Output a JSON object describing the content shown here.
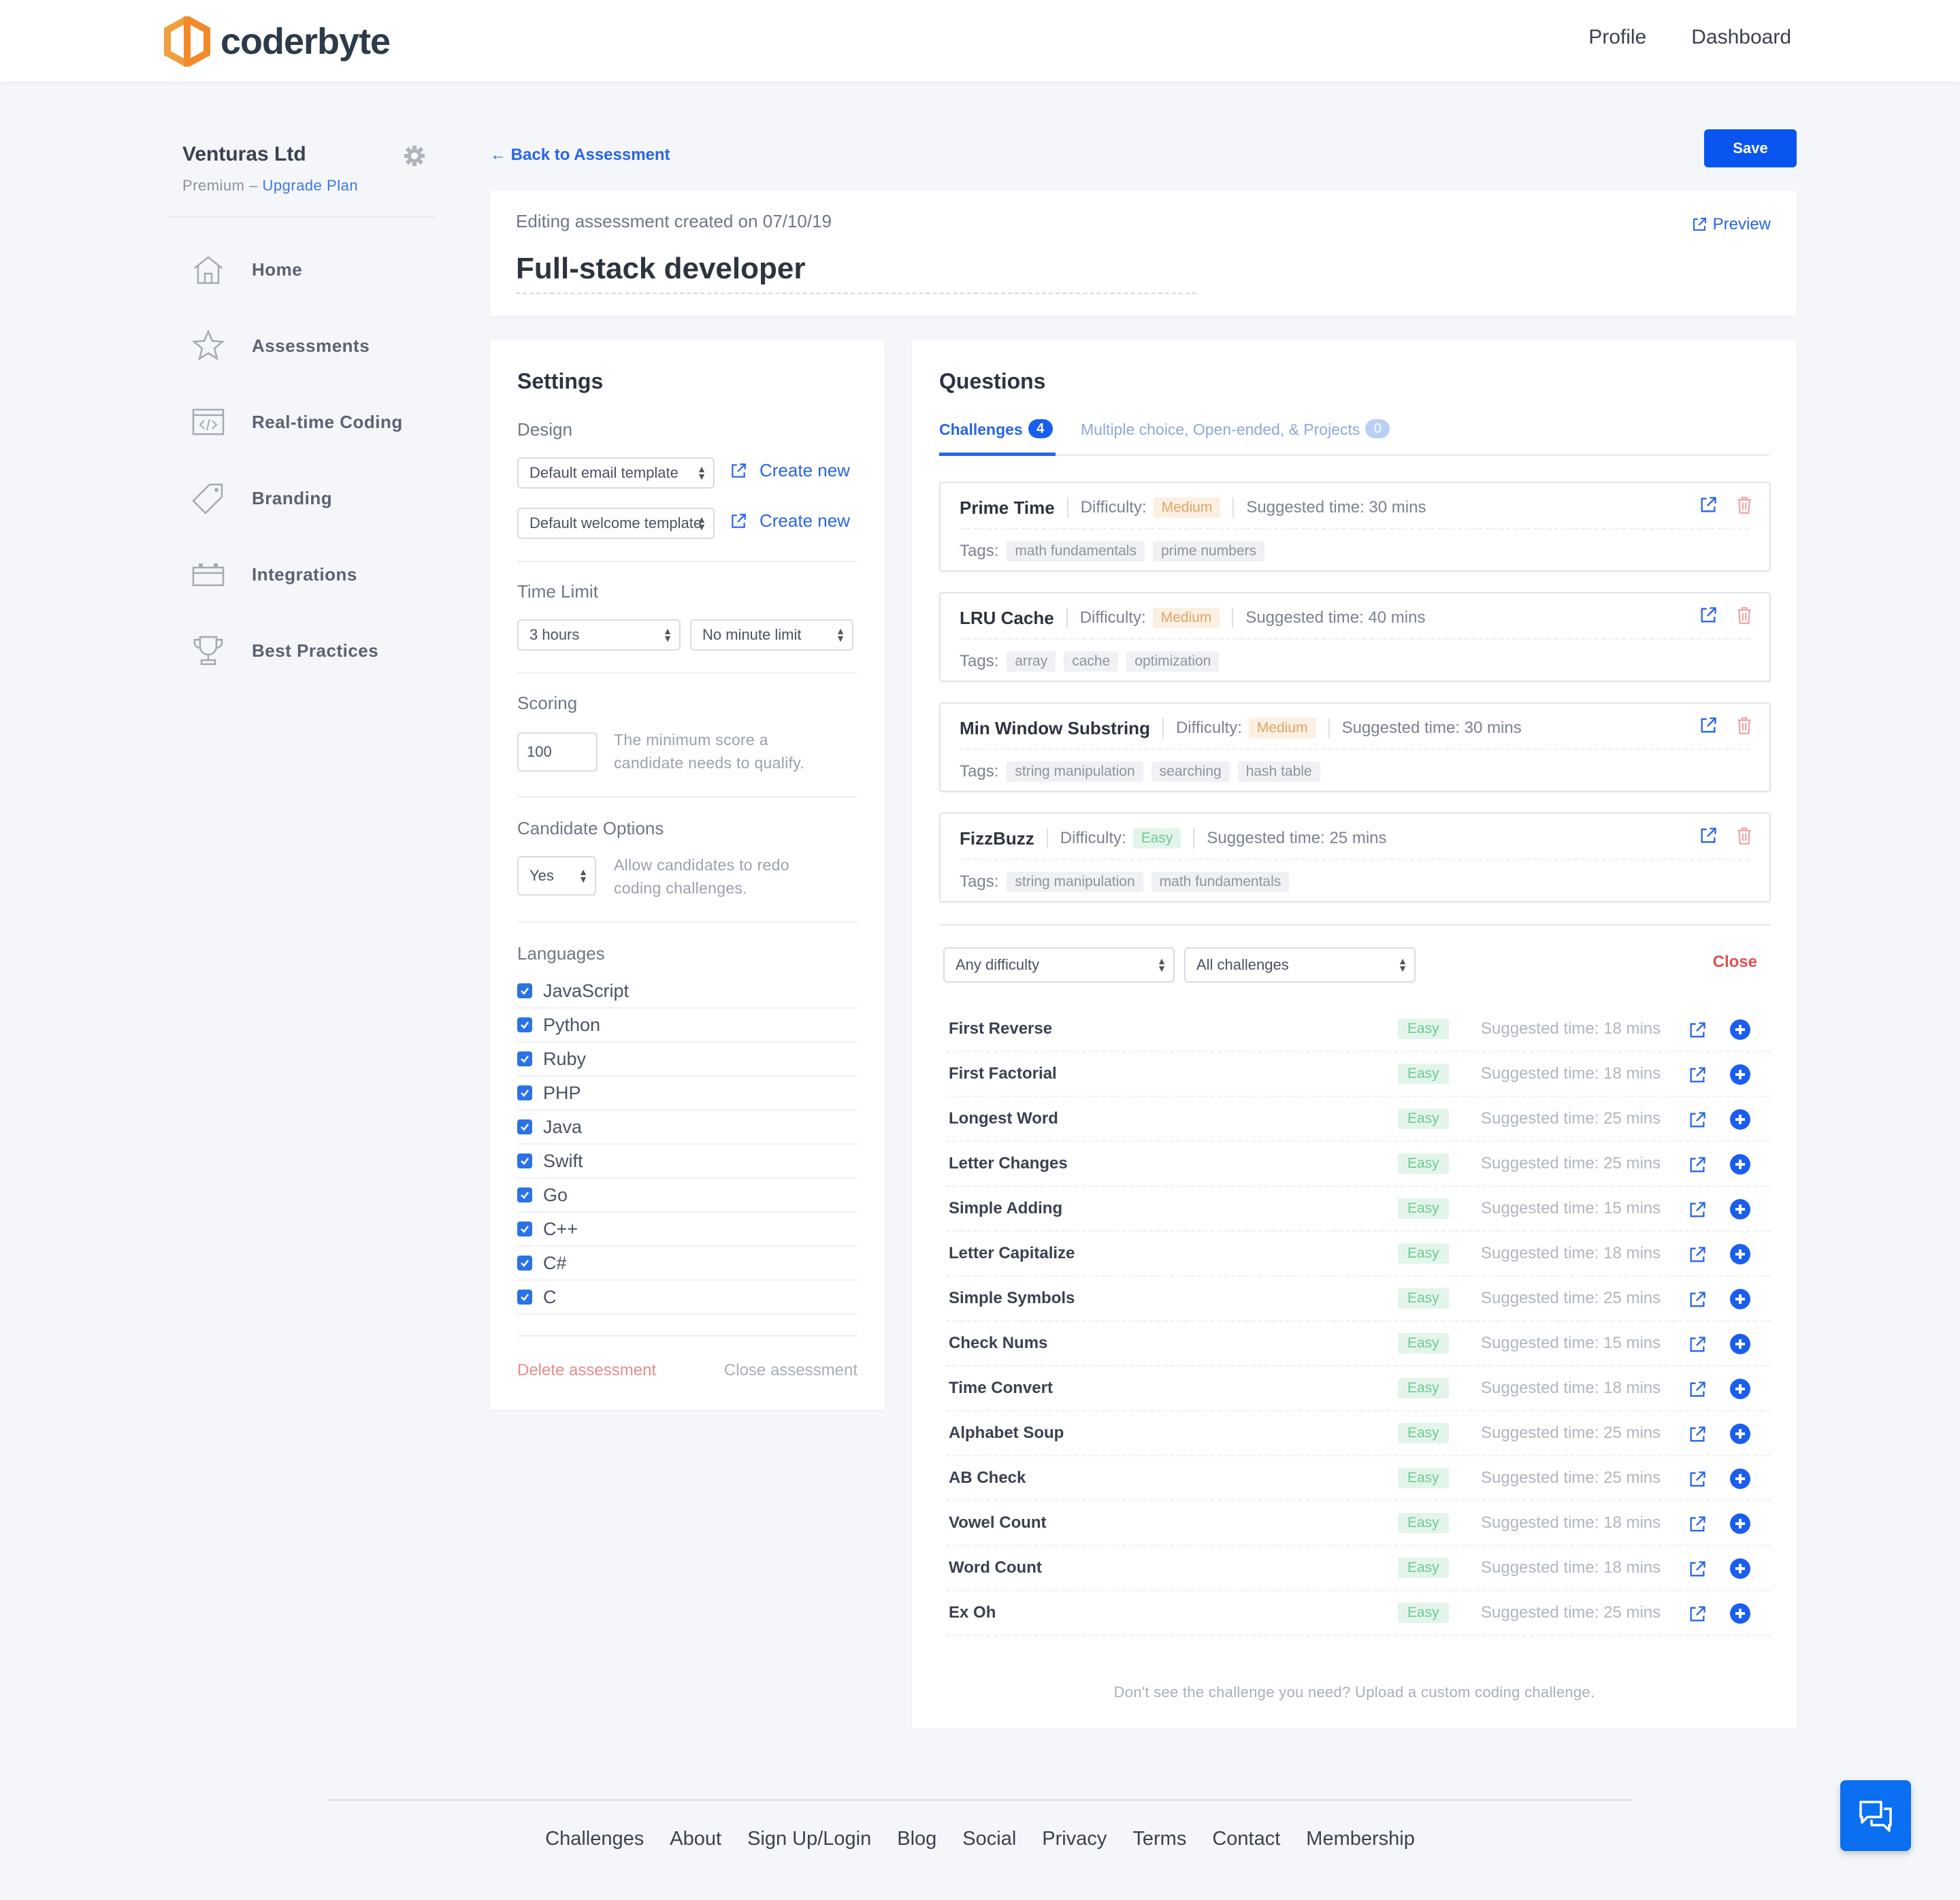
{
  "brand": {
    "name": "coderbyte"
  },
  "topnav": [
    "Profile",
    "Dashboard"
  ],
  "sidebar": {
    "org": "Venturas Ltd",
    "plan": "Premium",
    "plan_sep": "–",
    "upgrade": "Upgrade Plan",
    "items": [
      {
        "label": "Home",
        "icon": "home-icon"
      },
      {
        "label": "Assessments",
        "icon": "star-icon"
      },
      {
        "label": "Real-time Coding",
        "icon": "code-window-icon"
      },
      {
        "label": "Branding",
        "icon": "tag-icon"
      },
      {
        "label": "Integrations",
        "icon": "plug-icon"
      },
      {
        "label": "Best Practices",
        "icon": "trophy-icon"
      }
    ]
  },
  "back_label": "← Back to Assessment",
  "save_label": "Save",
  "header": {
    "subtitle": "Editing assessment created on 07/10/19",
    "title": "Full-stack developer",
    "preview": "Preview"
  },
  "settings": {
    "title": "Settings",
    "design_label": "Design",
    "email_template": "Default email template",
    "welcome_template": "Default welcome template",
    "create_new": "Create new",
    "time_limit_label": "Time Limit",
    "hours": "3 hours",
    "minutes": "No minute limit",
    "scoring_label": "Scoring",
    "score": "100",
    "scoring_help": "The minimum score a candidate needs to qualify.",
    "candidate_label": "Candidate Options",
    "redo": "Yes",
    "candidate_help": "Allow candidates to redo coding challenges.",
    "languages_label": "Languages",
    "languages": [
      "JavaScript",
      "Python",
      "Ruby",
      "PHP",
      "Java",
      "Swift",
      "Go",
      "C++",
      "C#",
      "C"
    ],
    "delete": "Delete assessment",
    "close": "Close assessment"
  },
  "questions": {
    "title": "Questions",
    "tab_challenges": "Challenges",
    "tab_challenges_count": "4",
    "tab_other": "Multiple choice, Open-ended, & Projects",
    "tab_other_count": "0",
    "difficulty_label": "Difficulty:",
    "tags_label": "Tags:",
    "selected": [
      {
        "name": "Prime Time",
        "difficulty": "Medium",
        "time": "Suggested time: 30 mins",
        "tags": [
          "math fundamentals",
          "prime numbers"
        ]
      },
      {
        "name": "LRU Cache",
        "difficulty": "Medium",
        "time": "Suggested time: 40 mins",
        "tags": [
          "array",
          "cache",
          "optimization"
        ]
      },
      {
        "name": "Min Window Substring",
        "difficulty": "Medium",
        "time": "Suggested time: 30 mins",
        "tags": [
          "string manipulation",
          "searching",
          "hash table"
        ]
      },
      {
        "name": "FizzBuzz",
        "difficulty": "Easy",
        "time": "Suggested time: 25 mins",
        "tags": [
          "string manipulation",
          "math fundamentals"
        ]
      }
    ],
    "filter_difficulty": "Any difficulty",
    "filter_challenges": "All challenges",
    "close_label": "Close",
    "library": [
      {
        "name": "First Reverse",
        "difficulty": "Easy",
        "time": "Suggested time: 18 mins"
      },
      {
        "name": "First Factorial",
        "difficulty": "Easy",
        "time": "Suggested time: 18 mins"
      },
      {
        "name": "Longest Word",
        "difficulty": "Easy",
        "time": "Suggested time: 25 mins"
      },
      {
        "name": "Letter Changes",
        "difficulty": "Easy",
        "time": "Suggested time: 25 mins"
      },
      {
        "name": "Simple Adding",
        "difficulty": "Easy",
        "time": "Suggested time: 15 mins"
      },
      {
        "name": "Letter Capitalize",
        "difficulty": "Easy",
        "time": "Suggested time: 18 mins"
      },
      {
        "name": "Simple Symbols",
        "difficulty": "Easy",
        "time": "Suggested time: 25 mins"
      },
      {
        "name": "Check Nums",
        "difficulty": "Easy",
        "time": "Suggested time: 15 mins"
      },
      {
        "name": "Time Convert",
        "difficulty": "Easy",
        "time": "Suggested time: 18 mins"
      },
      {
        "name": "Alphabet Soup",
        "difficulty": "Easy",
        "time": "Suggested time: 25 mins"
      },
      {
        "name": "AB Check",
        "difficulty": "Easy",
        "time": "Suggested time: 25 mins"
      },
      {
        "name": "Vowel Count",
        "difficulty": "Easy",
        "time": "Suggested time: 18 mins"
      },
      {
        "name": "Word Count",
        "difficulty": "Easy",
        "time": "Suggested time: 18 mins"
      },
      {
        "name": "Ex Oh",
        "difficulty": "Easy",
        "time": "Suggested time: 25 mins"
      }
    ],
    "custom_note": "Don't see the challenge you need? Upload a custom coding challenge."
  },
  "footer": [
    "Challenges",
    "About",
    "Sign Up/Login",
    "Blog",
    "Social",
    "Privacy",
    "Terms",
    "Contact",
    "Membership"
  ],
  "colors": {
    "accent": "#0a55f0",
    "link": "#2864e8",
    "danger": "#e05050",
    "medium": "#e0a465",
    "easy": "#6dcb92"
  }
}
